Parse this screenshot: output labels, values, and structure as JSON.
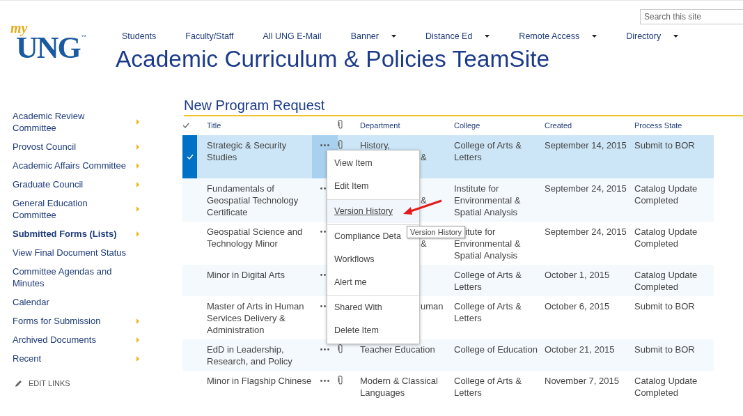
{
  "logo": {
    "script": "my",
    "main": "UNG",
    "mark": "™"
  },
  "search": {
    "placeholder": "Search this site"
  },
  "top_nav": [
    {
      "label": "Students",
      "dropdown": false
    },
    {
      "label": "Faculty/Staff",
      "dropdown": false
    },
    {
      "label": "All UNG E-Mail",
      "dropdown": false
    },
    {
      "label": "Banner",
      "dropdown": true
    },
    {
      "label": "Distance Ed",
      "dropdown": true
    },
    {
      "label": "Remote Access",
      "dropdown": true
    },
    {
      "label": "Directory",
      "dropdown": true
    }
  ],
  "site_title": "Academic Curriculum & Policies TeamSite",
  "sidebar": {
    "items": [
      {
        "label": "Academic Review Committee",
        "has_children": true,
        "selected": false
      },
      {
        "label": "Provost Council",
        "has_children": true,
        "selected": false
      },
      {
        "label": "Academic Affairs Committee",
        "has_children": true,
        "selected": false
      },
      {
        "label": "Graduate Council",
        "has_children": true,
        "selected": false
      },
      {
        "label": "General Education Committee",
        "has_children": true,
        "selected": false
      },
      {
        "label": "Submitted Forms (Lists)",
        "has_children": true,
        "selected": true
      },
      {
        "label": "View Final Document Status",
        "has_children": false,
        "selected": false
      },
      {
        "label": "Committee Agendas and Minutes",
        "has_children": false,
        "selected": false
      },
      {
        "label": "Calendar",
        "has_children": false,
        "selected": false
      },
      {
        "label": "Forms for Submission",
        "has_children": true,
        "selected": false
      },
      {
        "label": "Archived Documents",
        "has_children": true,
        "selected": false
      },
      {
        "label": "Recent",
        "has_children": true,
        "selected": false
      }
    ],
    "edit_links": "EDIT LINKS"
  },
  "list": {
    "title": "New Program Request",
    "columns": [
      "Title",
      "Department",
      "College",
      "Created",
      "Process State"
    ],
    "rows": [
      {
        "selected": true,
        "title": "Strategic & Security Studies",
        "attachment": true,
        "department": [
          {
            "text": "History,",
            "beside_menu": false
          },
          {
            "text": "&",
            "beside_menu": true,
            "before_hidden_line": true
          }
        ],
        "college": [
          {
            "text": "College of Arts & Letters"
          }
        ],
        "created": "September 14, 2015",
        "process_state": "Submit to BOR"
      },
      {
        "selected": false,
        "title": "Fundamentals of Geospatial Technology Certificate",
        "attachment": false,
        "department": [
          {
            "text": "&",
            "after_hidden_line": true,
            "beside_menu": true
          }
        ],
        "college": [
          {
            "text": "Institute for Environmental & Spatial Analysis"
          }
        ],
        "created": "September 24, 2015",
        "process_state": "Catalog Update Completed"
      },
      {
        "selected": false,
        "title": "Geospatial Science and Technology Minor",
        "attachment": false,
        "department": [
          {
            "text": "&",
            "after_hidden_line": true,
            "beside_menu": true
          }
        ],
        "college": [
          {
            "text": "itute for",
            "partly_covered": true
          },
          {
            "text": "Environmental & Spatial Analysis"
          }
        ],
        "created": "September 24, 2015",
        "process_state": "Catalog Update Completed"
      },
      {
        "selected": false,
        "title": "Minor in Digital Arts",
        "attachment": false,
        "department": [],
        "college": [
          {
            "text": "College of Arts & Letters"
          }
        ],
        "created": "October 1, 2015",
        "process_state": "Catalog Update Completed"
      },
      {
        "selected": false,
        "title": "Master of Arts in Human Services Delivery & Administration",
        "attachment": false,
        "department": [
          {
            "text": "uman",
            "beside_menu": true
          }
        ],
        "college": [
          {
            "text": "College of Arts & Letters"
          }
        ],
        "created": "October 6, 2015",
        "process_state": "Submit to BOR"
      },
      {
        "selected": false,
        "title": "EdD in Leadership, Research, and Policy",
        "attachment": true,
        "department": [
          {
            "text": "Teacher Education",
            "beside_menu": false
          }
        ],
        "college": [
          {
            "text": "College of Education"
          }
        ],
        "created": "October 21, 2015",
        "process_state": "Submit to BOR"
      },
      {
        "selected": false,
        "title": "Minor in Flagship Chinese",
        "attachment": true,
        "department": [
          {
            "text": "Modern & Classical Languages",
            "beside_menu": false
          }
        ],
        "college": [
          {
            "text": "College of Arts & Letters"
          }
        ],
        "created": "November 7, 2015",
        "process_state": "Catalog Update Completed"
      }
    ]
  },
  "context_menu": {
    "items": [
      {
        "label": "View Item",
        "separator_before": false,
        "hovered": false
      },
      {
        "label": "Edit Item",
        "separator_before": false,
        "hovered": false
      },
      {
        "label": "Version History",
        "separator_before": true,
        "hovered": true
      },
      {
        "label": "Compliance Deta",
        "separator_before": true,
        "hovered": false
      },
      {
        "label": "Workflows",
        "separator_before": false,
        "hovered": false
      },
      {
        "label": "Alert me",
        "separator_before": false,
        "hovered": false
      },
      {
        "label": "Shared With",
        "separator_before": true,
        "hovered": false
      },
      {
        "label": "Delete Item",
        "separator_before": false,
        "hovered": false
      }
    ]
  },
  "tooltip": "Version History"
}
